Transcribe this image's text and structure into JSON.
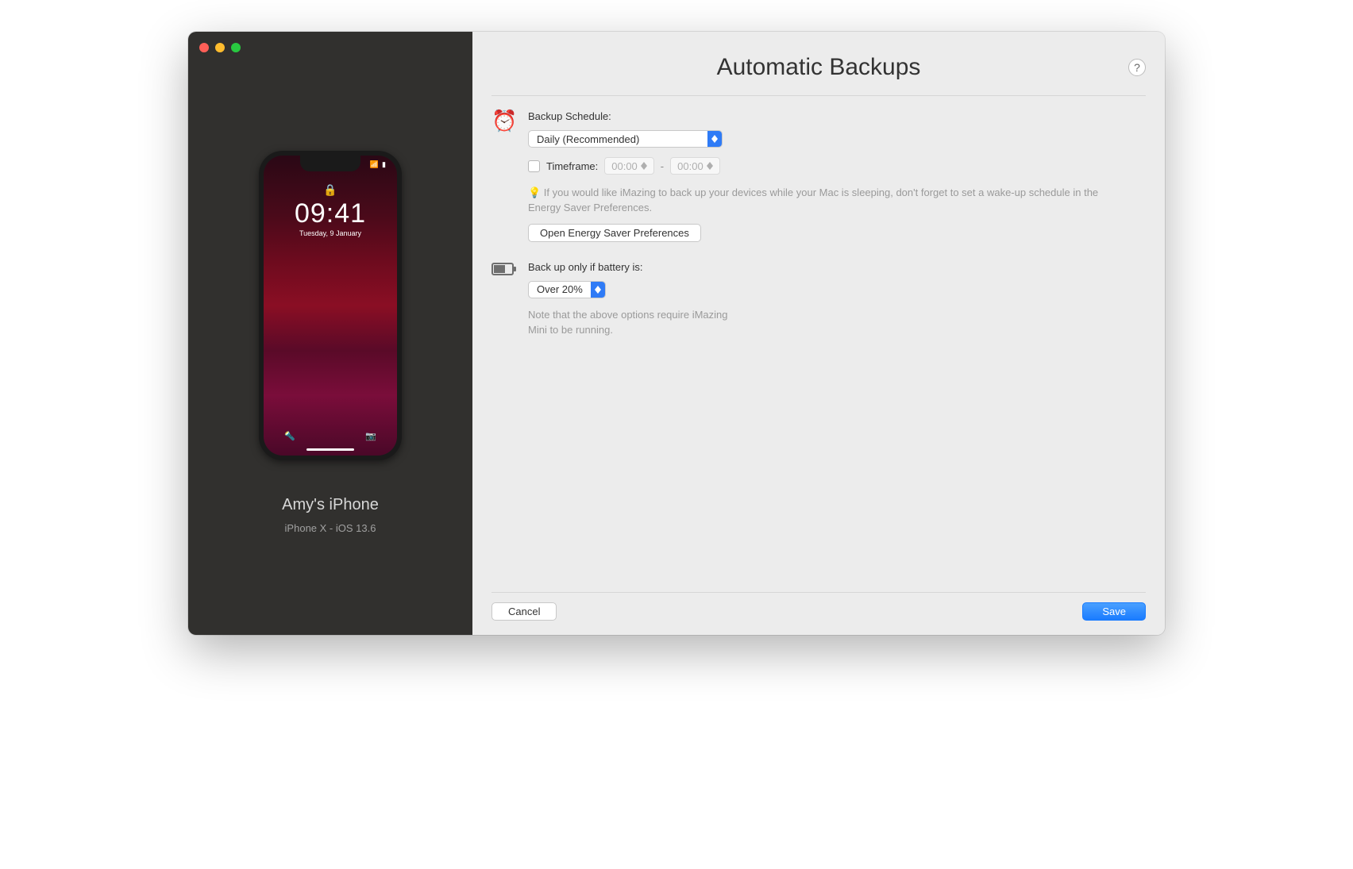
{
  "device": {
    "name": "Amy's iPhone",
    "info": "iPhone X - iOS 13.6",
    "time": "09:41",
    "date": "Tuesday, 9 January"
  },
  "page": {
    "title": "Automatic Backups",
    "help": "?"
  },
  "schedule": {
    "label": "Backup Schedule:",
    "selected": "Daily (Recommended)",
    "timeframe_label": "Timeframe:",
    "time_from": "00:00",
    "time_to": "00:00",
    "hint_bulb": "💡",
    "hint": " If you would like iMazing to back up your devices while your Mac is sleeping, don't forget to set a wake-up schedule in the Energy Saver Preferences.",
    "energy_button": "Open Energy Saver Preferences"
  },
  "battery": {
    "label": "Back up only if battery is:",
    "selected": "Over 20%",
    "note": "Note that the above options require iMazing Mini to be running."
  },
  "footer": {
    "cancel": "Cancel",
    "save": "Save"
  }
}
